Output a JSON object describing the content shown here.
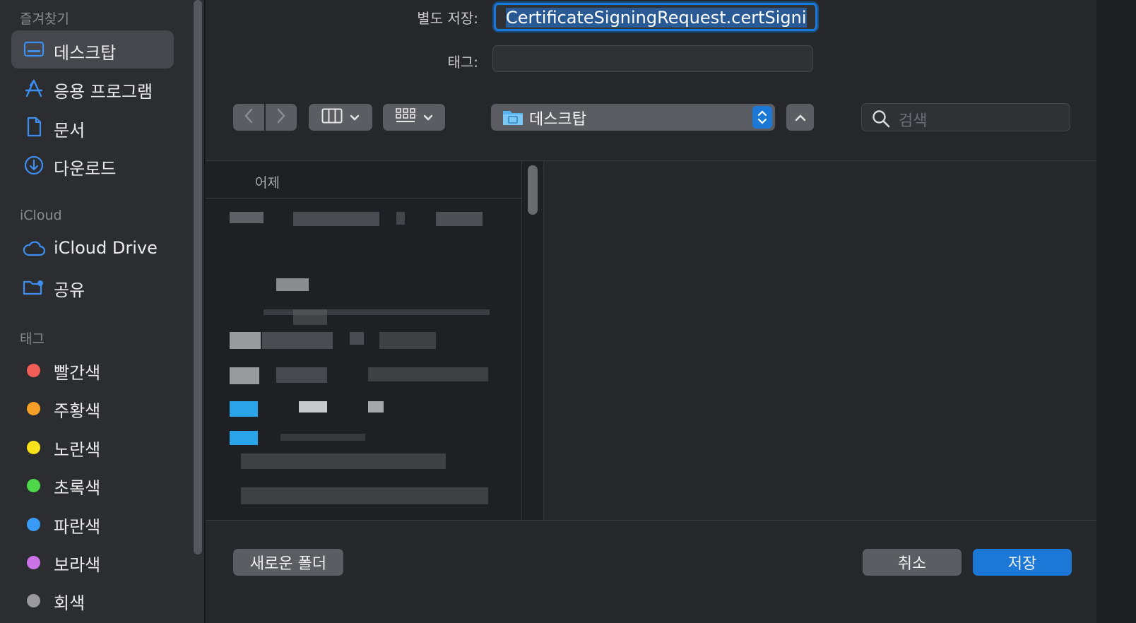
{
  "sidebar": {
    "favorites_title": "즐겨찾기",
    "favorites": [
      {
        "label": "데스크탑",
        "icon": "desktop-icon",
        "selected": true
      },
      {
        "label": "응용 프로그램",
        "icon": "applications-icon"
      },
      {
        "label": "문서",
        "icon": "document-icon"
      },
      {
        "label": "다운로드",
        "icon": "download-icon"
      }
    ],
    "icloud_title": "iCloud",
    "icloud": [
      {
        "label": "iCloud Drive",
        "icon": "cloud-icon"
      },
      {
        "label": "공유",
        "icon": "shared-folder-icon"
      }
    ],
    "tags_title": "태그",
    "tags": [
      {
        "label": "빨간색",
        "color": "#f25f58"
      },
      {
        "label": "주황색",
        "color": "#f7a028"
      },
      {
        "label": "노란색",
        "color": "#f8e21b"
      },
      {
        "label": "초록색",
        "color": "#4dd749"
      },
      {
        "label": "파란색",
        "color": "#3a9bf7"
      },
      {
        "label": "보라색",
        "color": "#cd73e8"
      },
      {
        "label": "회색",
        "color": "#9a9a9c"
      }
    ]
  },
  "form": {
    "save_as_label": "별도 저장:",
    "save_as_value": "CertificateSigningRequest.certSigni",
    "tags_label": "태그:",
    "location": "데스크탑",
    "search_placeholder": "검색"
  },
  "browser": {
    "column_header": "어제"
  },
  "buttons": {
    "new_folder": "새로운 폴더",
    "cancel": "취소",
    "save": "저장"
  },
  "colors": {
    "accent": "#1b78d6"
  }
}
